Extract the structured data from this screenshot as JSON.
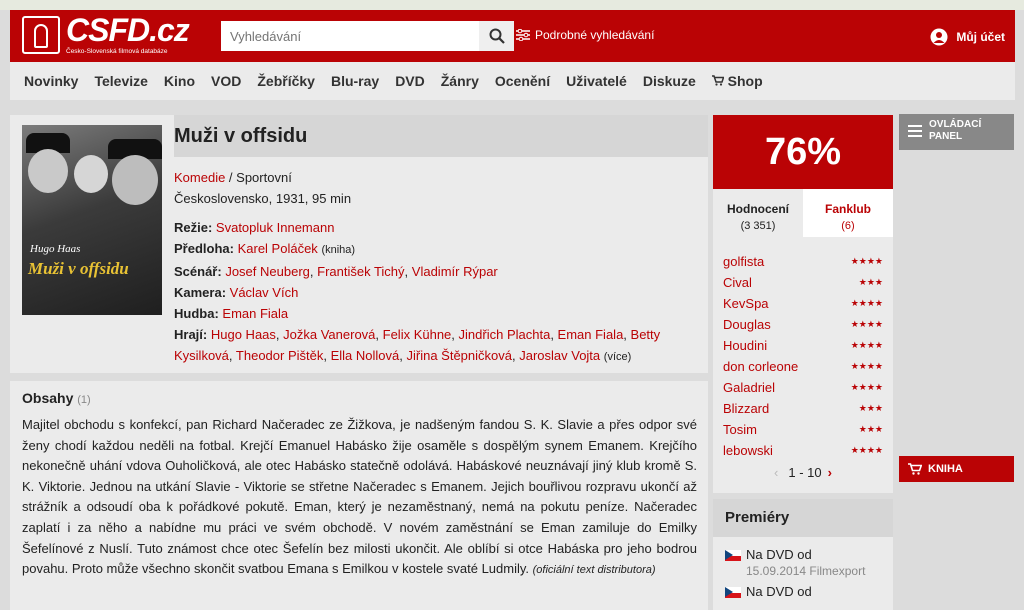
{
  "header": {
    "logo_text": "CSFD.cz",
    "logo_sub": "Česko-Slovenská filmová databáze",
    "search_placeholder": "Vyhledávání",
    "advanced_search": "Podrobné vyhledávání",
    "account": "Můj účet"
  },
  "nav": [
    "Novinky",
    "Televize",
    "Kino",
    "VOD",
    "Žebříčky",
    "Blu-ray",
    "DVD",
    "Žánry",
    "Ocenění",
    "Uživatelé",
    "Diskuze",
    "Shop"
  ],
  "film": {
    "title": "Muži v offsidu",
    "poster_actor": "Hugo Haas",
    "poster_title": "Muži v offsidu",
    "genres": [
      "Komedie",
      "Sportovní"
    ],
    "origin": "Československo, 1931, 95 min",
    "credits": {
      "rezie_label": "Režie:",
      "rezie": "Svatopluk Innemann",
      "predloha_label": "Předloha:",
      "predloha": "Karel Poláček",
      "predloha_note": "(kniha)",
      "scenar_label": "Scénář:",
      "scenar": [
        "Josef Neuberg",
        "František Tichý",
        "Vladimír Rýpar"
      ],
      "kamera_label": "Kamera:",
      "kamera": "Václav Vích",
      "hudba_label": "Hudba:",
      "hudba": "Eman Fiala",
      "hraji_label": "Hrají:",
      "hraji": [
        "Hugo Haas",
        "Jožka Vanerová",
        "Felix Kühne",
        "Jindřich Plachta",
        "Eman Fiala",
        "Betty Kysilková",
        "Theodor Pištěk",
        "Ella Nollová",
        "Jiřina Štěpničková",
        "Jaroslav Vojta"
      ],
      "more": "(více)"
    }
  },
  "plot": {
    "heading": "Obsahy",
    "count": "(1)",
    "text": "Majitel obchodu s konfekcí, pan Richard Načeradec ze Žižkova, je nadšeným fandou S. K. Slavie a přes odpor své ženy chodí každou neděli na fotbal. Krejčí Emanuel Habásko žije osaměle s dospělým synem Emanem. Krejčího nekonečně uhání vdova Ouholičková, ale otec Habásko statečně odolává. Habáskové neuznávají jiný klub kromě S. K. Viktorie. Jednou na utkání Slavie - Viktorie se střetne Načeradec s Emanem. Jejich bouřlivou rozpravu ukončí až strážník a odsoudí oba k pořádkové pokutě. Eman, který je nezaměstnaný, nemá na pokutu peníze. Načeradec zaplatí i za něho a nabídne mu práci ve svém obchodě. V novém zaměstnání se Eman zamiluje do Emilky Šefelínové z Nuslí. Tuto známost chce otec Šefelín bez milosti ukončit. Ale oblíbí si otce Habáska pro jeho bodrou povahu. Proto může všechno skončit svatbou Emana s Emilkou v kostele svaté Ludmily.",
    "source": "(oficiální text distributora)"
  },
  "rating": {
    "score": "76%",
    "tab_ratings": "Hodnocení",
    "tab_ratings_count": "(3 351)",
    "tab_fanclub": "Fanklub",
    "tab_fanclub_count": "(6)",
    "users": [
      {
        "name": "golfista",
        "stars": 4
      },
      {
        "name": "Cival",
        "stars": 3
      },
      {
        "name": "KevSpa",
        "stars": 4
      },
      {
        "name": "Douglas",
        "stars": 4
      },
      {
        "name": "Houdini",
        "stars": 4
      },
      {
        "name": "don corleone",
        "stars": 4
      },
      {
        "name": "Galadriel",
        "stars": 4
      },
      {
        "name": "Blizzard",
        "stars": 3
      },
      {
        "name": "Tosim",
        "stars": 3
      },
      {
        "name": "lebowski",
        "stars": 4
      }
    ],
    "pager": "1 - 10"
  },
  "side": {
    "panel_line1": "OVLÁDACÍ",
    "panel_line2": "PANEL",
    "book": "KNIHA"
  },
  "premieres": {
    "heading": "Premiéry",
    "items": [
      {
        "label": "Na DVD od",
        "date": "15.09.2014 Filmexport"
      },
      {
        "label": "Na DVD od",
        "date": ""
      }
    ]
  },
  "colors": {
    "accent": "#ba0305",
    "panel_bg": "#ebebeb",
    "page_bg": "#dcdcdc"
  }
}
